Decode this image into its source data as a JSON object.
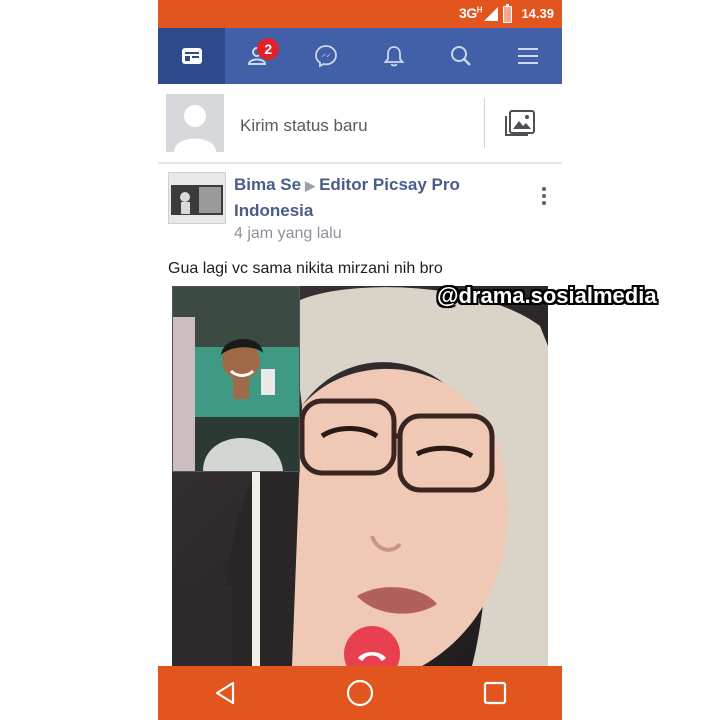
{
  "status_bar": {
    "network": "3G",
    "network_sup": "H",
    "time": "14.39"
  },
  "nav": {
    "items": [
      {
        "name": "news-feed",
        "icon": "news-feed-icon"
      },
      {
        "name": "friend-requests",
        "icon": "friends-icon",
        "badge": "2"
      },
      {
        "name": "messenger",
        "icon": "messenger-icon"
      },
      {
        "name": "notifications",
        "icon": "bell-icon"
      },
      {
        "name": "search",
        "icon": "search-icon"
      },
      {
        "name": "menu",
        "icon": "menu-icon"
      }
    ]
  },
  "compose": {
    "placeholder": "Kirim status baru"
  },
  "post": {
    "author": "Bima Se",
    "target_page": "Editor Picsay Pro Indonesia",
    "time": "4 jam yang lalu",
    "caption": "Gua lagi vc sama nikita mirzani nih bro"
  },
  "watermark": "@drama.sosialmedia",
  "colors": {
    "status_bar": "#e2551f",
    "nav_bar": "#4160a8",
    "badge": "#e0202a",
    "end_call": "#e84050"
  }
}
